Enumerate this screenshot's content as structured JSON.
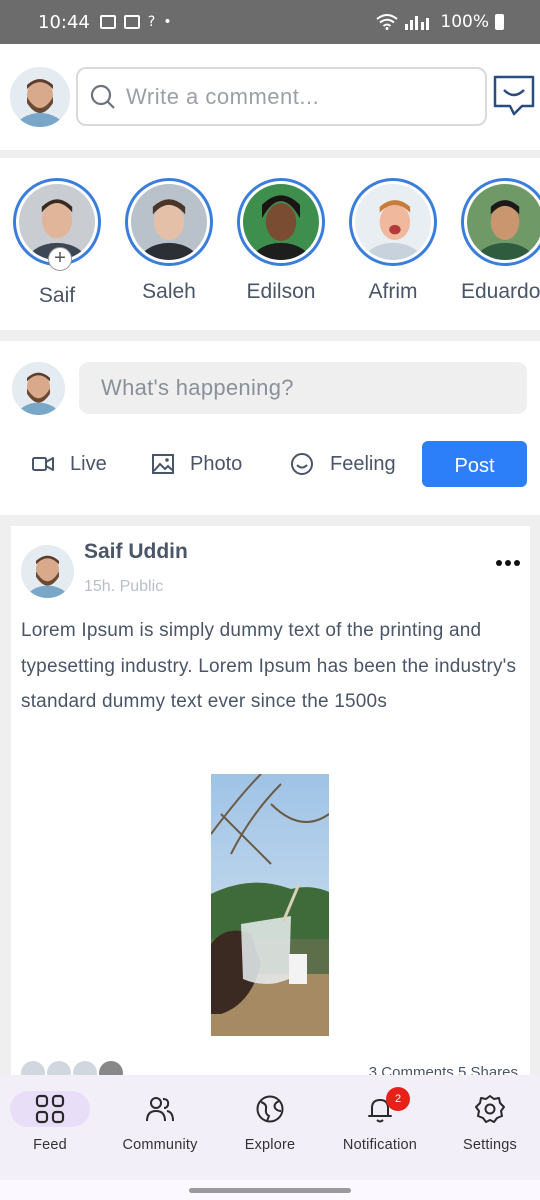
{
  "status_bar": {
    "time": "10:44",
    "battery": "100%"
  },
  "topbar": {
    "comment_placeholder": "Write a comment..."
  },
  "stories": [
    {
      "name": "Saif"
    },
    {
      "name": "Saleh"
    },
    {
      "name": "Edilson"
    },
    {
      "name": "Afrim"
    },
    {
      "name": "Eduardo"
    }
  ],
  "composer": {
    "placeholder": "What's happening?",
    "live_label": "Live",
    "photo_label": "Photo",
    "feeling_label": "Feeling",
    "post_label": "Post"
  },
  "post": {
    "author": "Saif Uddin",
    "meta": "15h. Public",
    "text": "Lorem Ipsum is simply dummy text of the printing and typesetting industry. Lorem Ipsum has been the industry's standard dummy text ever since the 1500s",
    "stats": "3 Comments  5 Shares"
  },
  "bottom_nav": {
    "feed": "Feed",
    "community": "Community",
    "explore": "Explore",
    "notification": "Notification",
    "notification_badge": "2",
    "settings": "Settings"
  },
  "colors": {
    "accent": "#2d7ff9",
    "story_ring": "#3b7ddd",
    "badge": "#e8201a"
  }
}
